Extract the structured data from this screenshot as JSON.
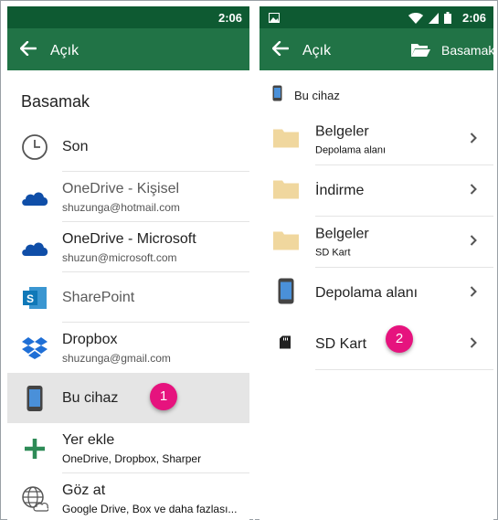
{
  "status_bar": {
    "time": "2:06"
  },
  "left": {
    "appbar_title": "Açık",
    "section_title": "Basamak",
    "items": [
      {
        "label": "Son",
        "sub": ""
      },
      {
        "label": "OneDrive -  Kişisel",
        "sub": "shuzunga@hotmail.com"
      },
      {
        "label": "OneDrive - Microsoft",
        "sub": "shuzun@microsoft.com"
      },
      {
        "label": "SharePoint",
        "sub": ""
      },
      {
        "label": "Dropbox",
        "sub": "shuzunga@gmail.com"
      },
      {
        "label": "Bu cihaz",
        "sub": ""
      },
      {
        "label": "Yer ekle",
        "sub": "OneDrive, Dropbox, Sharper"
      },
      {
        "label": "Göz at",
        "sub": "Google Drive, Box ve daha fazlası..."
      }
    ],
    "badge": "1"
  },
  "right": {
    "appbar_title": "Açık",
    "appbar_location": "Basamak",
    "breadcrumb": "Bu cihaz",
    "items": [
      {
        "label": "Belgeler",
        "sub": "Depolama alanı"
      },
      {
        "label": "İndirme",
        "sub": ""
      },
      {
        "label": "Belgeler",
        "sub": "SD Kart"
      },
      {
        "label": "Depolama alanı",
        "sub": ""
      },
      {
        "label": "SD Kart",
        "sub": ""
      }
    ],
    "badge": "2"
  },
  "colors": {
    "status_bar": "#0e5a32",
    "app_bar": "#217346",
    "badge": "#e6137e",
    "onedrive": "#0f4ea8",
    "sharepoint": "#0f78b8",
    "dropbox": "#1f6fd6",
    "add": "#2e8b57",
    "folder": "#f0d79e",
    "selected_row": "#e5e5e5"
  },
  "icons": {
    "left": [
      "clock-icon",
      "onedrive-cloud-icon",
      "onedrive-cloud-icon",
      "sharepoint-icon",
      "dropbox-icon",
      "phone-icon",
      "plus-icon",
      "globe-cloud-icon"
    ],
    "right": [
      "folder-icon",
      "folder-icon",
      "folder-icon",
      "phone-icon",
      "sd-card-icon"
    ]
  }
}
